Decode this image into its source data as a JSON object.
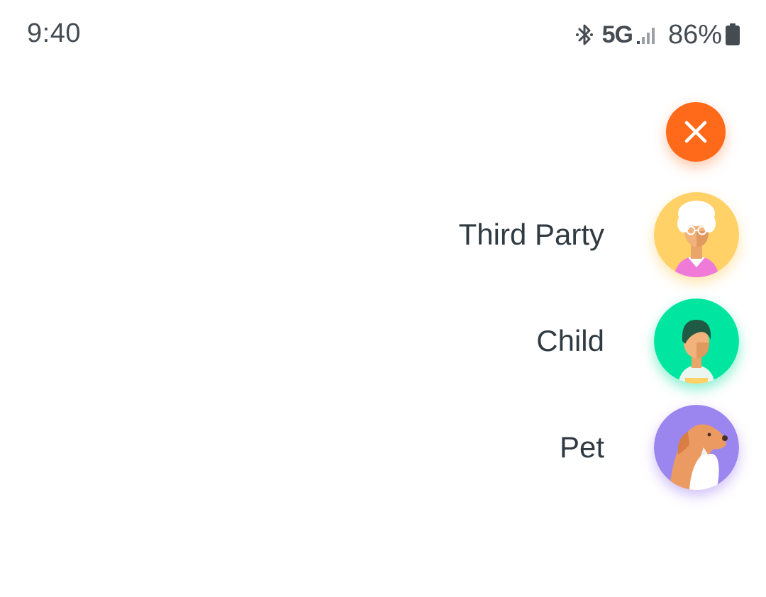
{
  "status_bar": {
    "time": "9:40",
    "network": "5G",
    "battery_percent": "86%",
    "icons": [
      "bluetooth-icon",
      "signal-icon",
      "battery-icon"
    ]
  },
  "fab": {
    "icon": "close-icon",
    "color": "#ff6a1a"
  },
  "options": [
    {
      "label": "Third Party",
      "avatar": "elderly-woman-avatar",
      "color": "#ffd166"
    },
    {
      "label": "Child",
      "avatar": "child-avatar",
      "color": "#00e6a0"
    },
    {
      "label": "Pet",
      "avatar": "dog-cat-avatar",
      "color": "#9b86f0"
    }
  ]
}
